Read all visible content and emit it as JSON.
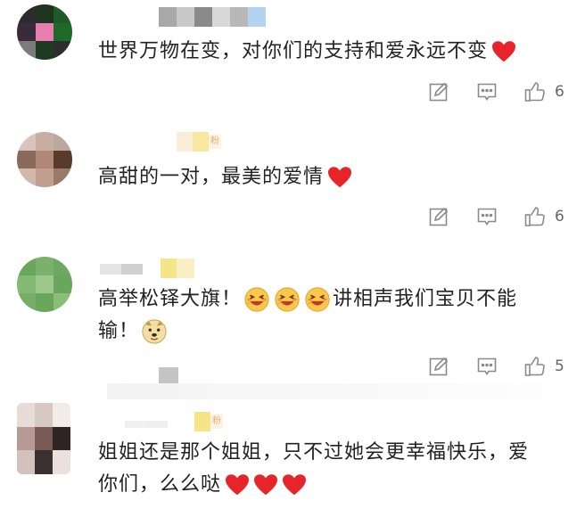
{
  "comments": [
    {
      "text": "世界万物在变，对你们的支持和爱永远不变",
      "hearts": 1,
      "likes": "6"
    },
    {
      "text": "高甜的一对，最美的爱情",
      "hearts": 1,
      "likes": "6"
    },
    {
      "text_line1": "高举松铎大旗！",
      "text_line1b": "讲相声我们宝贝不能",
      "text_line2": "输！",
      "likes": "5"
    },
    {
      "text_line1": "姐姐还是那个姐姐，只不过她会更幸福快乐，爱",
      "text_line2": "你们，么么哒",
      "hearts": 3
    }
  ],
  "colors": {
    "heart": "#e8242b",
    "icon": "#8a8a8a",
    "text": "#222222"
  },
  "icons": [
    "edit-icon",
    "comment-icon",
    "thumbs-up-icon",
    "heart-icon",
    "laughing-emoji-icon",
    "doge-emoji-icon"
  ]
}
